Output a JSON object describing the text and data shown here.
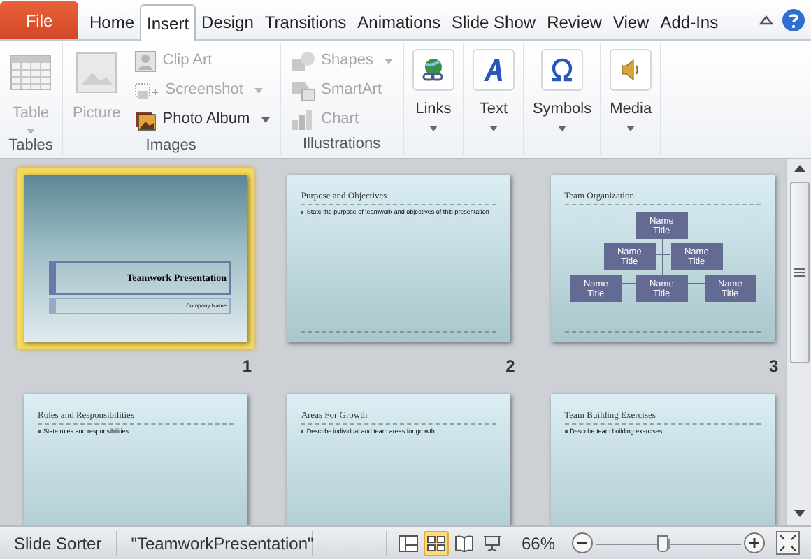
{
  "tabs": [
    {
      "label": "File",
      "kind": "file",
      "selected": false
    },
    {
      "label": "Home",
      "kind": "tab",
      "selected": false
    },
    {
      "label": "Insert",
      "kind": "tab",
      "selected": true
    },
    {
      "label": "Design",
      "kind": "tab",
      "selected": false
    },
    {
      "label": "Transitions",
      "kind": "tab",
      "selected": false
    },
    {
      "label": "Animations",
      "kind": "tab",
      "selected": false
    },
    {
      "label": "Slide Show",
      "kind": "tab",
      "selected": false
    },
    {
      "label": "Review",
      "kind": "tab",
      "selected": false
    },
    {
      "label": "View",
      "kind": "tab",
      "selected": false
    },
    {
      "label": "Add-Ins",
      "kind": "tab",
      "selected": false
    }
  ],
  "ribbon": [
    {
      "label": "Tables",
      "items": [
        {
          "label": "Table",
          "kind": "large",
          "disabled": true,
          "dropdown": true
        }
      ]
    },
    {
      "label": "Images",
      "items": [
        {
          "label": "Picture",
          "kind": "large",
          "disabled": true,
          "dropdown": false
        },
        {
          "label": "Clip Art",
          "kind": "small",
          "disabled": true,
          "dropdown": false
        },
        {
          "label": "Screenshot",
          "kind": "small",
          "disabled": true,
          "dropdown": true
        },
        {
          "label": "Photo Album",
          "kind": "small",
          "disabled": false,
          "dropdown": true
        }
      ]
    },
    {
      "label": "Illustrations",
      "items": [
        {
          "label": "Shapes",
          "kind": "small",
          "disabled": true,
          "dropdown": true
        },
        {
          "label": "SmartArt",
          "kind": "small",
          "disabled": true,
          "dropdown": false
        },
        {
          "label": "Chart",
          "kind": "small",
          "disabled": true,
          "dropdown": false
        }
      ]
    },
    {
      "items": [
        {
          "label": "Links",
          "kind": "boxed",
          "disabled": false,
          "dropdown": true
        }
      ]
    },
    {
      "items": [
        {
          "label": "Text",
          "kind": "boxed",
          "disabled": false,
          "dropdown": true
        }
      ]
    },
    {
      "items": [
        {
          "label": "Symbols",
          "kind": "boxed",
          "disabled": false,
          "dropdown": true
        }
      ]
    },
    {
      "items": [
        {
          "label": "Media",
          "kind": "boxed",
          "disabled": false,
          "dropdown": true
        }
      ]
    }
  ],
  "slides": [
    {
      "kind": "title",
      "number": "1",
      "selected": true,
      "title": "Teamwork Presentation",
      "subtitle": "Company Name"
    },
    {
      "kind": "bullets",
      "number": "2",
      "selected": false,
      "title": "Purpose and Objectives",
      "bullet": "State the purpose of teamwork and objectives of this presentation"
    },
    {
      "kind": "org",
      "number": "3",
      "selected": false,
      "title": "Team Organization",
      "boxes": [
        {
          "name": "Name",
          "role": "Title"
        },
        {
          "name": "Name",
          "role": "Title"
        },
        {
          "name": "Name",
          "role": "Title"
        },
        {
          "name": "Name",
          "role": "Title"
        },
        {
          "name": "Name",
          "role": "Title"
        },
        {
          "name": "Name",
          "role": "Title"
        }
      ]
    },
    {
      "kind": "bullets",
      "selected": false,
      "title": "Roles and Responsibilities",
      "bullet": "State roles and responsibilities"
    },
    {
      "kind": "bullets",
      "selected": false,
      "title": "Areas For Growth",
      "bullet": "Describe individual and team areas for growth"
    },
    {
      "kind": "bullets",
      "selected": false,
      "title": "Team Building Exercises",
      "bullet": "Describe team building exercises"
    }
  ],
  "status_bar": {
    "view": "Slide Sorter",
    "file": "\"TeamworkPresentation\"",
    "views": [
      {
        "kind": "normal",
        "selected": false
      },
      {
        "kind": "sorter",
        "selected": true
      },
      {
        "kind": "reading",
        "selected": false
      },
      {
        "kind": "show",
        "selected": false
      }
    ],
    "zoom": "66%",
    "zoom_slider": {
      "level": 0.46
    }
  }
}
